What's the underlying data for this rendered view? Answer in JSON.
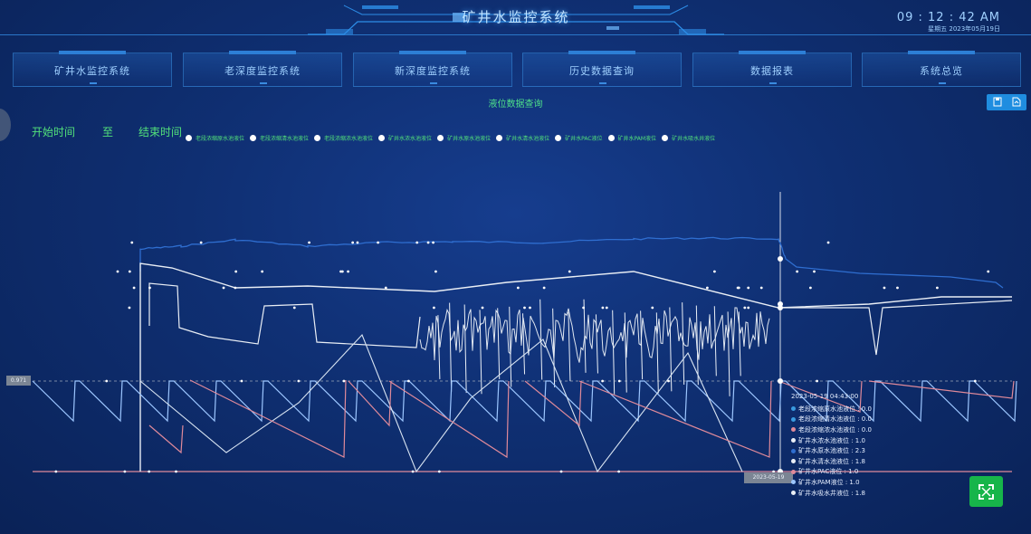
{
  "header": {
    "title": "矿井水监控系统",
    "time": "09 : 12 : 42  AM",
    "date_line": "星期五    2023年05月19日"
  },
  "nav": [
    {
      "label": "矿井水监控系统"
    },
    {
      "label": "老深度监控系统"
    },
    {
      "label": "新深度监控系统"
    },
    {
      "label": "历史数据查询"
    },
    {
      "label": "数据报表"
    },
    {
      "label": "系统总览"
    }
  ],
  "page_label": "液位数据查询",
  "filters": {
    "start_label": "开始时间",
    "to_label": "至",
    "end_label": "结束时间"
  },
  "toolbar": {
    "save_icon": "save-icon",
    "export_icon": "export-icon"
  },
  "legend": [
    "老段浓缩原水池液位",
    "老段浓缩清水池液位",
    "老段浓缩浓水池液位",
    "矿井水浓水池液位",
    "矿井水原水池液位",
    "矿井水清水池液位",
    "矿井水PAC液位",
    "矿井水PAM液位",
    "矿井水吸水井液位"
  ],
  "colors": {
    "accent": "#1f8de0",
    "green_text": "#52e07a",
    "series_blue": "#9cc6ff",
    "series_pink": "#e08a9a",
    "series_white": "#e9eef5",
    "series_darkblue": "#2f6ed0"
  },
  "tooltip": {
    "time": "2023-05-19 04:43:00",
    "rows": [
      {
        "label": "老段浓缩原水池液位 : 0.0",
        "color": "#3a9be0"
      },
      {
        "label": "老段浓缩清水池液位 : 0.0",
        "color": "#3a9be0"
      },
      {
        "label": "老段浓缩浓水池液位 : 0.0",
        "color": "#e08a9a"
      },
      {
        "label": "矿井水浓水池液位 : 1.0",
        "color": "#e9eef5"
      },
      {
        "label": "矿井水原水池液位 : 2.3",
        "color": "#2f6ed0"
      },
      {
        "label": "矿井水清水池液位 : 1.8",
        "color": "#e9eef5"
      },
      {
        "label": "矿井水PAC液位 : 1.0",
        "color": "#e08a9a"
      },
      {
        "label": "矿井水PAM液位 : 1.0",
        "color": "#9cc6ff"
      },
      {
        "label": "矿井水吸水井液位 : 1.8",
        "color": "#e9eef5"
      }
    ]
  },
  "axis_pointer": {
    "y_value": "0.971",
    "x_value": "2023-05-19 04:43:00"
  },
  "fullscreen_icon": "expand-icon"
}
